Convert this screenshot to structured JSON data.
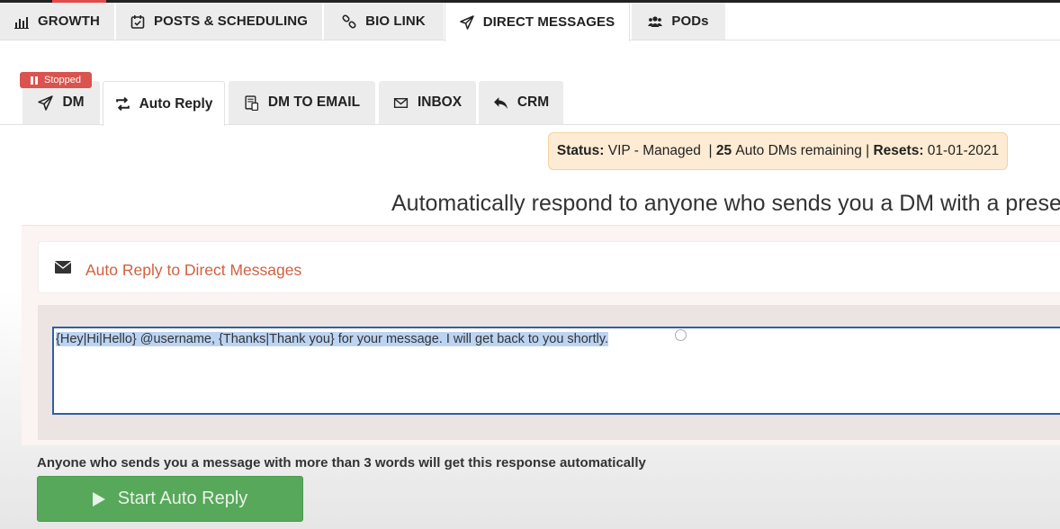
{
  "main_tabs": [
    {
      "label": "GROWTH",
      "icon": "bar-chart-icon"
    },
    {
      "label": "POSTS & SCHEDULING",
      "icon": "calendar-check-icon"
    },
    {
      "label": "BIO LINK",
      "icon": "link-icon"
    },
    {
      "label": "DIRECT MESSAGES",
      "icon": "paper-plane-icon",
      "active": true
    },
    {
      "label": "PODs",
      "icon": "users-icon"
    }
  ],
  "sub_tabs": [
    {
      "label": "DM",
      "icon": "paper-plane-icon"
    },
    {
      "label": "Auto Reply",
      "icon": "retweet-icon",
      "active": true
    },
    {
      "label": "DM TO EMAIL",
      "icon": "document-phone-icon"
    },
    {
      "label": "INBOX",
      "icon": "envelope-icon"
    },
    {
      "label": "CRM",
      "icon": "reply-icon"
    }
  ],
  "badge": {
    "label": "Stopped",
    "color": "#d9534f"
  },
  "status": {
    "status_label": "Status:",
    "status_value": "VIP - Managed",
    "sep1": "|",
    "count": "25",
    "count_text": "Auto DMs remaining",
    "sep2": "|",
    "resets_label": "Resets:",
    "resets_value": "01-01-2021"
  },
  "headline": "Automatically respond to anyone who sends you a DM with a prese",
  "panel": {
    "title": "Auto Reply to Direct Messages",
    "message": "{Hey|Hi|Hello} @username, {Thanks|Thank you} for your message. I will get back to you shortly."
  },
  "note": "Anyone who sends you a message with more than 3 words will get this response automatically",
  "start_button": "Start Auto Reply",
  "colors": {
    "accent_orange": "#d2603f",
    "button_green": "#57a85a",
    "status_bg": "#fdebd3",
    "selection": "#bcd4f2"
  }
}
